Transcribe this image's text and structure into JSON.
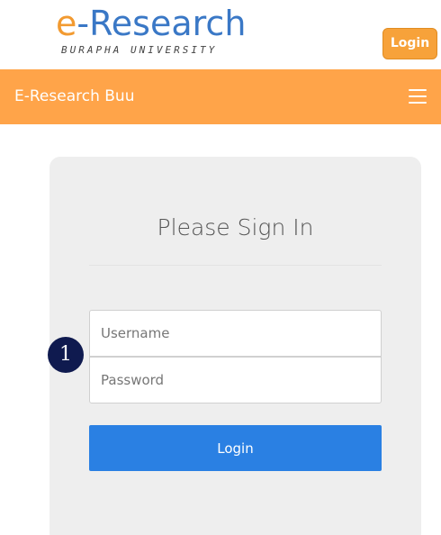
{
  "header": {
    "logo": {
      "prefix": "e",
      "rest": "-Research",
      "subtitle": "BURAPHA UNIVERSITY"
    },
    "login_button": "Login"
  },
  "navbar": {
    "brand": "E-Research Buu",
    "menu_icon": "hamburger-menu-icon"
  },
  "signin": {
    "title": "Please Sign In",
    "username_placeholder": "Username",
    "password_placeholder": "Password",
    "submit_label": "Login"
  },
  "annotation": {
    "marker_label": "1"
  },
  "colors": {
    "accent_orange": "#ffa449",
    "logo_blue": "#3a78c6",
    "primary_blue": "#2a80e3",
    "panel_bg": "#eeeeee",
    "marker_navy": "#0f1a4f"
  }
}
